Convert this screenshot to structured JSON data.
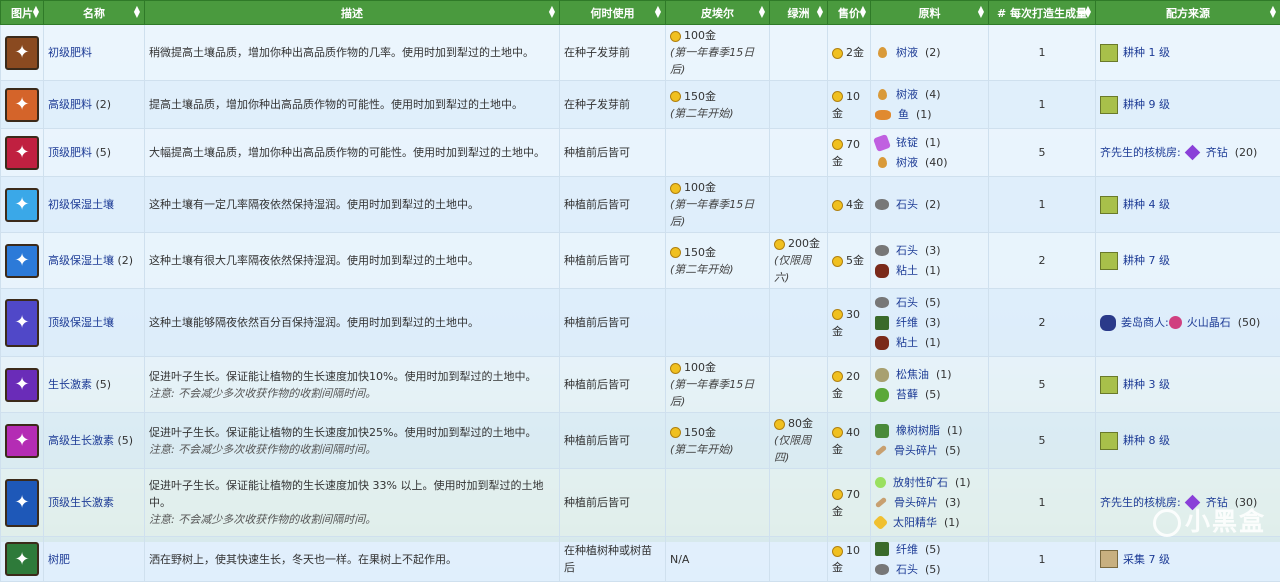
{
  "headers": [
    "图片",
    "名称",
    "描述",
    "何时使用",
    "皮埃尔",
    "绿洲",
    "售价",
    "原料",
    "# 每次打造生成量",
    "配方来源"
  ],
  "rows": [
    {
      "icon": "basic-fertilizer",
      "name": "初级肥料",
      "count": "",
      "desc": "稍微提高土壤品质，增加你种出高品质作物的几率。使用时加到犁过的土地中。",
      "note": "",
      "when": "在种子发芽前",
      "pierre": "100金",
      "pierre_note": "(第一年春季15日后)",
      "oasis": "",
      "oasis_note": "",
      "price": "2金",
      "materials": [
        {
          "icon": "sap",
          "name": "树液",
          "qty": "(2)"
        }
      ],
      "yield": "1",
      "source": {
        "type": "farming",
        "text": "耕种 1 级"
      }
    },
    {
      "icon": "quality-fertilizer",
      "name": "高级肥料",
      "count": "(2)",
      "desc": "提高土壤品质，增加你种出高品质作物的可能性。使用时加到犁过的土地中。",
      "note": "",
      "when": "在种子发芽前",
      "pierre": "150金",
      "pierre_note": "(第二年开始)",
      "oasis": "",
      "oasis_note": "",
      "price": "10金",
      "materials": [
        {
          "icon": "sap",
          "name": "树液",
          "qty": "(4)"
        },
        {
          "icon": "fish",
          "name": "鱼",
          "qty": "(1)"
        }
      ],
      "yield": "1",
      "source": {
        "type": "farming",
        "text": "耕种 9 级"
      }
    },
    {
      "icon": "deluxe-fertilizer",
      "name": "顶级肥料",
      "count": "(5)",
      "desc": "大幅提高土壤品质，增加你种出高品质作物的可能性。使用时加到犁过的土地中。",
      "note": "",
      "when": "种植前后皆可",
      "pierre": "",
      "pierre_note": "",
      "oasis": "",
      "oasis_note": "",
      "price": "70金",
      "materials": [
        {
          "icon": "iridium-bar",
          "name": "铱锭",
          "qty": "(1)"
        },
        {
          "icon": "sap",
          "name": "树液",
          "qty": "(40)"
        }
      ],
      "yield": "5",
      "source": {
        "type": "qi",
        "text": "齐先生的核桃房:",
        "extra": "齐钻",
        "extra_qty": "(20)"
      }
    },
    {
      "icon": "basic-retaining-soil",
      "name": "初级保湿土壤",
      "count": "",
      "desc": "这种土壤有一定几率隔夜依然保持湿润。使用时加到犁过的土地中。",
      "note": "",
      "when": "种植前后皆可",
      "pierre": "100金",
      "pierre_note": "(第一年春季15日后)",
      "oasis": "",
      "oasis_note": "",
      "price": "4金",
      "materials": [
        {
          "icon": "stone",
          "name": "石头",
          "qty": "(2)"
        }
      ],
      "yield": "1",
      "source": {
        "type": "farming",
        "text": "耕种 4 级"
      }
    },
    {
      "icon": "quality-retaining-soil",
      "name": "高级保湿土壤",
      "count": "(2)",
      "desc": "这种土壤有很大几率隔夜依然保持湿润。使用时加到犁过的土地中。",
      "note": "",
      "when": "种植前后皆可",
      "pierre": "150金",
      "pierre_note": "(第二年开始)",
      "oasis": "200金",
      "oasis_note": "(仅限周六)",
      "price": "5金",
      "materials": [
        {
          "icon": "stone",
          "name": "石头",
          "qty": "(3)"
        },
        {
          "icon": "clay",
          "name": "粘土",
          "qty": "(1)"
        }
      ],
      "yield": "2",
      "source": {
        "type": "farming",
        "text": "耕种 7 级"
      }
    },
    {
      "icon": "deluxe-retaining-soil",
      "name": "顶级保湿土壤",
      "count": "",
      "desc": "这种土壤能够隔夜依然百分百保持湿润。使用时加到犁过的土地中。",
      "note": "",
      "when": "种植前后皆可",
      "pierre": "",
      "pierre_note": "",
      "oasis": "",
      "oasis_note": "",
      "price": "30金",
      "materials": [
        {
          "icon": "stone",
          "name": "石头",
          "qty": "(5)"
        },
        {
          "icon": "fiber",
          "name": "纤维",
          "qty": "(3)"
        },
        {
          "icon": "clay",
          "name": "粘土",
          "qty": "(1)"
        }
      ],
      "yield": "2",
      "source": {
        "type": "gourmand",
        "text": "姜岛商人:",
        "extra": "火山晶石",
        "extra_qty": "(50)"
      }
    },
    {
      "icon": "speed-gro",
      "name": "生长激素",
      "count": "(5)",
      "desc": "促进叶子生长。保证能让植物的生长速度加快10%。使用时加到犁过的土地中。",
      "note": "注意: 不会减少多次收获作物的收割间隔时间。",
      "when": "种植前后皆可",
      "pierre": "100金",
      "pierre_note": "(第一年春季15日后)",
      "oasis": "",
      "oasis_note": "",
      "price": "20金",
      "materials": [
        {
          "icon": "pine-tar",
          "name": "松焦油",
          "qty": "(1)"
        },
        {
          "icon": "moss",
          "name": "苔藓",
          "qty": "(5)"
        }
      ],
      "yield": "5",
      "source": {
        "type": "farming",
        "text": "耕种 3 级"
      }
    },
    {
      "icon": "deluxe-speed-gro",
      "name": "高级生长激素",
      "count": "(5)",
      "desc": "促进叶子生长。保证能让植物的生长速度加快25%。使用时加到犁过的土地中。",
      "note": "注意: 不会减少多次收获作物的收割间隔时间。",
      "when": "种植前后皆可",
      "pierre": "150金",
      "pierre_note": "(第二年开始)",
      "oasis": "80金",
      "oasis_note": "(仅限周四)",
      "price": "40金",
      "materials": [
        {
          "icon": "oak-resin",
          "name": "橡树树脂",
          "qty": "(1)"
        },
        {
          "icon": "bone-fragment",
          "name": "骨头碎片",
          "qty": "(5)"
        }
      ],
      "yield": "5",
      "source": {
        "type": "farming",
        "text": "耕种 8 级"
      }
    },
    {
      "icon": "hyper-speed-gro",
      "name": "顶级生长激素",
      "count": "",
      "desc": "促进叶子生长。保证能让植物的生长速度加快 33% 以上。使用时加到犁过的土地中。",
      "note": "注意: 不会减少多次收获作物的收割间隔时间。",
      "when": "种植前后皆可",
      "pierre": "",
      "pierre_note": "",
      "oasis": "",
      "oasis_note": "",
      "price": "70金",
      "materials": [
        {
          "icon": "radioactive-ore",
          "name": "放射性矿石",
          "qty": "(1)"
        },
        {
          "icon": "bone-fragment",
          "name": "骨头碎片",
          "qty": "(3)"
        },
        {
          "icon": "solar-essence",
          "name": "太阳精华",
          "qty": "(1)"
        }
      ],
      "yield": "1",
      "source": {
        "type": "qi",
        "text": "齐先生的核桃房:",
        "extra": "齐钻",
        "extra_qty": "(30)"
      }
    },
    {
      "icon": "tree-fertilizer",
      "name": "树肥",
      "count": "",
      "desc": "洒在野树上，使其快速生长，冬天也一样。在果树上不起作用。",
      "note": "",
      "when": "在种植树种或树苗后",
      "pierre": "N/A",
      "pierre_note": "",
      "oasis": "",
      "oasis_note": "",
      "price": "10金",
      "materials": [
        {
          "icon": "fiber",
          "name": "纤维",
          "qty": "(5)"
        },
        {
          "icon": "stone",
          "name": "石头",
          "qty": "(5)"
        }
      ],
      "yield": "1",
      "source": {
        "type": "foraging",
        "text": "采集 7 级"
      }
    }
  ],
  "watermark": "小黑盒"
}
